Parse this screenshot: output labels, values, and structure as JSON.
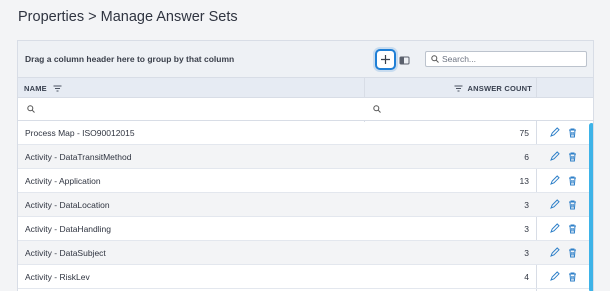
{
  "breadcrumb": "Properties > Manage Answer Sets",
  "toolbar": {
    "group_hint": "Drag a column header here to group by that column",
    "search_placeholder": "Search..."
  },
  "columns": {
    "name": "NAME",
    "count": "ANSWER COUNT"
  },
  "rows": [
    {
      "name": "Process Map - ISO90012015",
      "count": "75"
    },
    {
      "name": "Activity - DataTransitMethod",
      "count": "6"
    },
    {
      "name": "Activity - Application",
      "count": "13"
    },
    {
      "name": "Activity - DataLocation",
      "count": "3"
    },
    {
      "name": "Activity - DataHandling",
      "count": "3"
    },
    {
      "name": "Activity - DataSubject",
      "count": "3"
    },
    {
      "name": "Activity - RiskLev",
      "count": "4"
    }
  ],
  "icons": {
    "add": "plus-icon",
    "column_chooser": "column-chooser-icon",
    "search": "search-icon",
    "filter": "filter-icon",
    "edit": "pencil-icon",
    "delete": "trash-icon"
  },
  "colors": {
    "accent": "#1f7fd6",
    "scrollbar": "#3db3e8"
  }
}
